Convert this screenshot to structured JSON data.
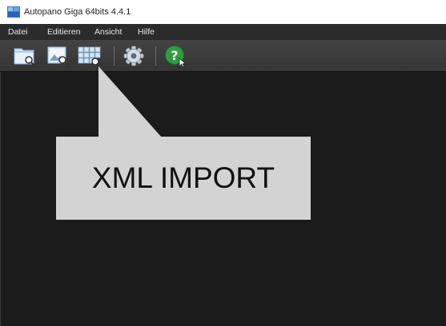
{
  "window": {
    "title": "Autopano Giga 64bits 4.4.1"
  },
  "menu": {
    "items": [
      {
        "label": "Datei"
      },
      {
        "label": "Editieren"
      },
      {
        "label": "Ansicht"
      },
      {
        "label": "Hilfe"
      }
    ]
  },
  "toolbar": {
    "buttons": [
      {
        "icon": "folder-search-icon"
      },
      {
        "icon": "image-search-icon"
      },
      {
        "icon": "grid-import-icon"
      },
      {
        "icon": "gear-icon"
      },
      {
        "icon": "help-icon"
      }
    ]
  },
  "callout": {
    "text": "XML IMPORT"
  },
  "colors": {
    "menubar": "#2b2b2b",
    "toolbar": "#3c3c3c",
    "workspace": "#1b1b1b",
    "callout": "#d3d3d3",
    "help": "#2e9e3e"
  }
}
